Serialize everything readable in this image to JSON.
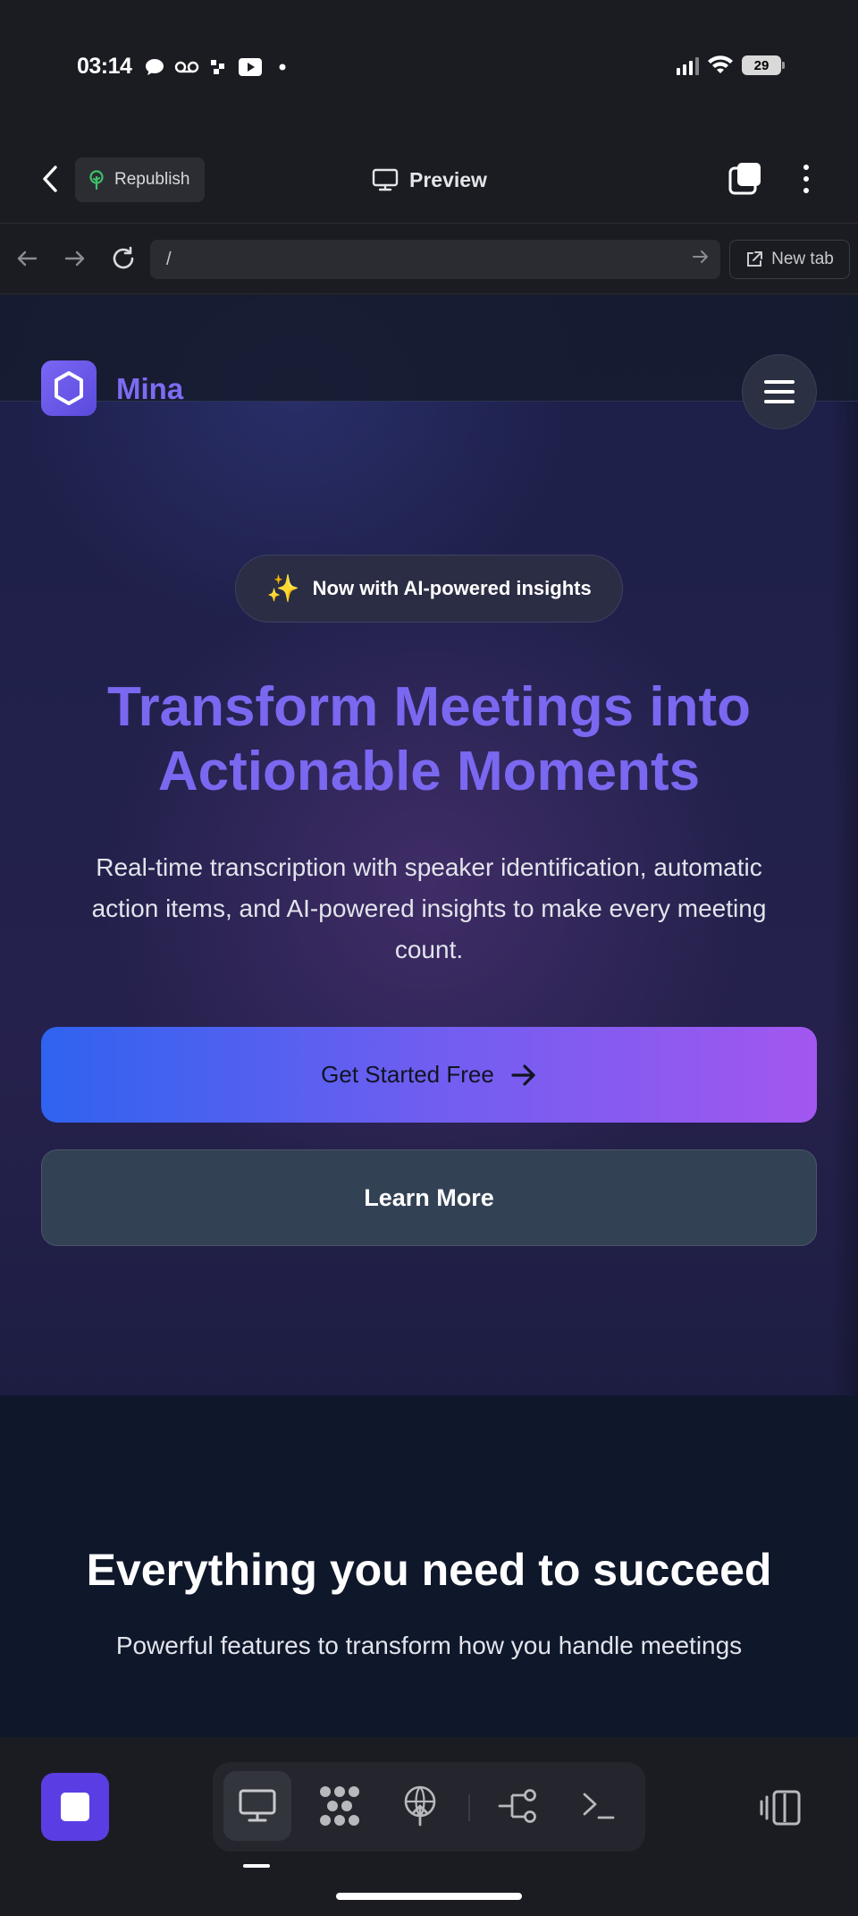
{
  "status_bar": {
    "time": "03:14",
    "battery": "29",
    "notification_icons": [
      "chat-bubble-icon",
      "voicemail-icon",
      "slack-dots-icon",
      "youtube-icon",
      "dot-icon"
    ],
    "system_icons": [
      "signal-icon",
      "wifi-icon",
      "battery-icon"
    ]
  },
  "toolbar": {
    "republish_label": "Republish",
    "preview_label": "Preview"
  },
  "url_bar": {
    "url": "/",
    "new_tab_label": "New tab"
  },
  "site": {
    "brand": "Mina",
    "badge_text": "Now with AI-powered insights",
    "badge_icon": "sparkles-icon",
    "headline_line1": "Transform Meetings into",
    "headline_line2": "Actionable Moments",
    "subheadline": "Real-time transcription with speaker identification, automatic action items, and AI-powered insights to make every meeting count.",
    "cta_primary": "Get Started Free",
    "cta_secondary": "Learn More",
    "features_title": "Everything you need to succeed",
    "features_subtitle": "Powerful features to transform how you handle meetings"
  },
  "bottom_bar": {
    "tools": [
      "preview-icon",
      "grid-icon",
      "deploy-icon",
      "branch-icon",
      "terminal-icon"
    ],
    "active_tool": "preview-icon"
  },
  "colors": {
    "brand_purple": "#7a68f0",
    "cta_gradient_start": "#2f63ef",
    "cta_gradient_end": "#a257f0",
    "stop_button": "#5b3ee3",
    "secondary_button": "#334155"
  }
}
